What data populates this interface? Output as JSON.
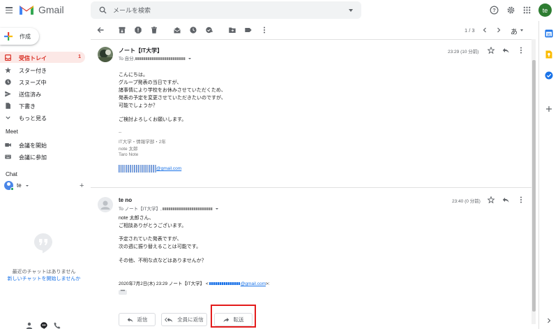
{
  "header": {
    "app_name": "Gmail",
    "search_placeholder": "メールを検索",
    "avatar_initials": "te"
  },
  "compose": {
    "label": "作成"
  },
  "nav": {
    "items": [
      {
        "label": "受信トレイ",
        "count": "1",
        "active": true
      },
      {
        "label": "スター付き"
      },
      {
        "label": "スヌーズ中"
      },
      {
        "label": "送信済み"
      },
      {
        "label": "下書き"
      },
      {
        "label": "もっと見る"
      }
    ]
  },
  "meet": {
    "title": "Meet",
    "items": [
      {
        "label": "会議を開始"
      },
      {
        "label": "会議に参加"
      }
    ]
  },
  "chat": {
    "title": "Chat",
    "user_name": "te",
    "no_chats": "最近のチャットはありません",
    "start_new": "新しいチャットを開始しませんか"
  },
  "toolbar": {
    "page_count": "1 / 3",
    "ime_label": "あ"
  },
  "messages": [
    {
      "sender": "ノート【IT大学】",
      "to_prefix": "To 自分,",
      "time": "23:29 (10 分前)",
      "body": [
        "こんにちは。",
        "グループ発表の当日ですが、",
        "諸事情により学校をお休みさせていただくため、",
        "発表の予定を変更させていただきたいのですが、",
        "可能でしょうか？",
        "",
        "ご検討よろしくお願いします。"
      ],
      "signature": [
        "--",
        "IT大学・情報学部・2年",
        "note 太郎",
        "Taro Note"
      ],
      "email_suffix": "@gmail.com"
    },
    {
      "sender": "te no",
      "to_prefix": "To ノート【IT大学】,",
      "time": "23:40 (0 分前)",
      "body": [
        "note 太郎さん、",
        "ご相談ありがとうございます。",
        "",
        "予定されていた発表ですが、",
        "次の週に振り替えることは可能です。",
        "",
        "その他、不明な点などはありませんか？"
      ],
      "quote_prefix": "2020年7月2日(木) 23:29 ノート【IT大学】 <",
      "quote_email": "@gmail.com",
      "quote_suffix": ">:",
      "ellipsis": "•••"
    }
  ],
  "actions": {
    "reply": "返信",
    "reply_all": "全員に返信",
    "forward": "転送"
  },
  "colors": {
    "gmail_red": "#d93025",
    "link_blue": "#1a73e8",
    "highlight_red": "#e31b1b",
    "avatar_green": "#2e7d32"
  }
}
